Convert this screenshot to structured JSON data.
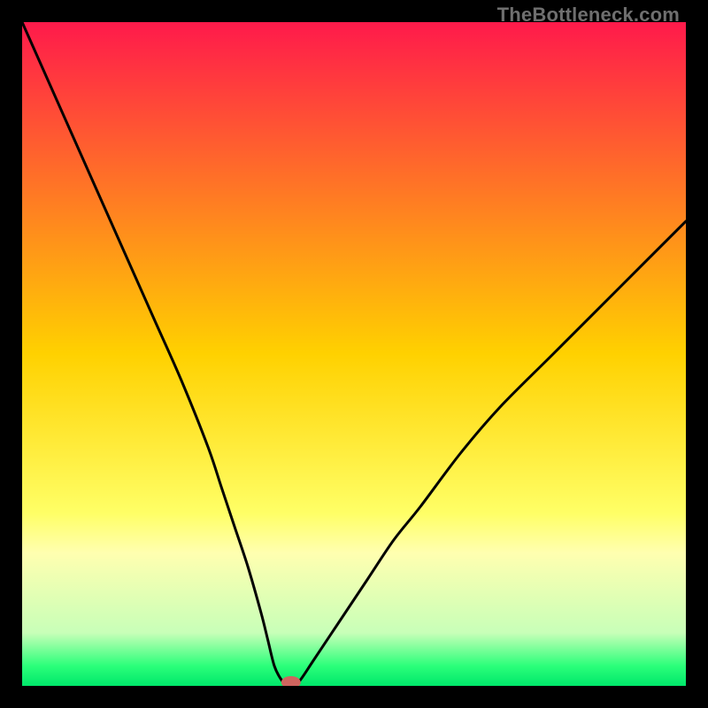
{
  "watermark": "TheBottleneck.com",
  "chart_data": {
    "type": "line",
    "title": "",
    "xlabel": "",
    "ylabel": "",
    "xlim": [
      0,
      100
    ],
    "ylim": [
      0,
      100
    ],
    "background_gradient": {
      "stops": [
        {
          "offset": 0.0,
          "color": "#ff1a4b"
        },
        {
          "offset": 0.5,
          "color": "#ffd100"
        },
        {
          "offset": 0.74,
          "color": "#ffff66"
        },
        {
          "offset": 0.8,
          "color": "#ffffb0"
        },
        {
          "offset": 0.92,
          "color": "#c8ffb8"
        },
        {
          "offset": 0.97,
          "color": "#2bff7a"
        },
        {
          "offset": 1.0,
          "color": "#00e76a"
        }
      ]
    },
    "series": [
      {
        "name": "bottleneck-curve",
        "type": "line",
        "color": "#000000",
        "x": [
          0,
          4,
          8,
          12,
          16,
          20,
          24,
          28,
          30,
          32,
          34,
          36,
          37,
          38,
          39,
          40,
          41,
          42,
          44,
          48,
          52,
          56,
          60,
          66,
          72,
          80,
          90,
          100
        ],
        "values": [
          100,
          91,
          82,
          73,
          64,
          55,
          46,
          36,
          30,
          24,
          18,
          11,
          7,
          3,
          1,
          0,
          0,
          1,
          4,
          10,
          16,
          22,
          27,
          35,
          42,
          50,
          60,
          70
        ]
      }
    ],
    "marker": {
      "name": "optimal-point",
      "x": 40.5,
      "y": 0,
      "color": "#cf655f",
      "rx": 11,
      "ry": 7
    }
  }
}
